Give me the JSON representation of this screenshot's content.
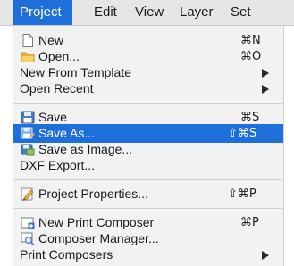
{
  "menubar": {
    "items": [
      {
        "label": "Project"
      },
      {
        "label": "Edit"
      },
      {
        "label": "View"
      },
      {
        "label": "Layer"
      },
      {
        "label": "Set"
      }
    ],
    "active": "Project"
  },
  "menu": {
    "new": {
      "label": "New",
      "shortcut": "⌘N",
      "icon": "new-document-icon"
    },
    "open": {
      "label": "Open...",
      "shortcut": "⌘O",
      "icon": "folder-icon"
    },
    "new_from_template": {
      "label": "New From Template"
    },
    "open_recent": {
      "label": "Open Recent"
    },
    "save": {
      "label": "Save",
      "shortcut": "⌘S",
      "icon": "floppy-disk-icon"
    },
    "save_as": {
      "label": "Save As...",
      "shortcut": "⇧⌘S",
      "icon": "save-as-icon"
    },
    "save_as_image": {
      "label": "Save as Image...",
      "icon": "save-image-icon"
    },
    "dxf_export": {
      "label": "DXF Export..."
    },
    "project_properties": {
      "label": "Project Properties...",
      "shortcut": "⇧⌘P",
      "icon": "project-properties-icon"
    },
    "new_print_composer": {
      "label": "New Print Composer",
      "shortcut": "⌘P",
      "icon": "new-composer-icon"
    },
    "composer_manager": {
      "label": "Composer Manager...",
      "icon": "composer-manager-icon"
    },
    "print_composers": {
      "label": "Print Composers"
    }
  },
  "colors": {
    "selection": "#1e6fd9",
    "menu_background": "#f2f2f2"
  }
}
